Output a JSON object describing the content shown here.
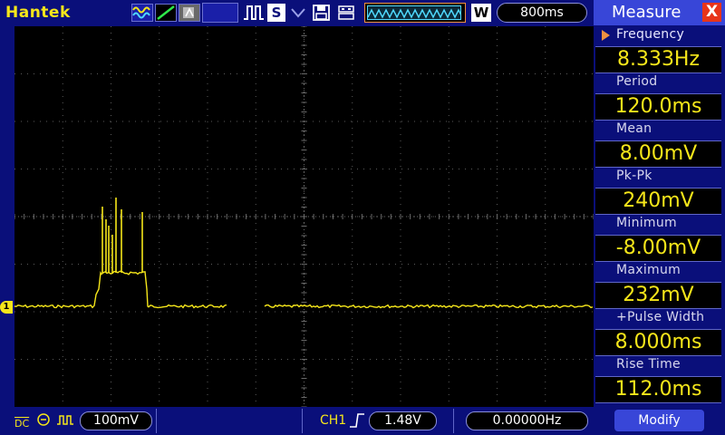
{
  "brand": "Hantek",
  "toolbar": {
    "run_mode_label": "S",
    "trigger_mode_label": "W",
    "timebase": "800ms"
  },
  "bottom": {
    "ch1_coupling": "DC",
    "ch1_volts_div": "100mV",
    "trigger_source": "CH1",
    "trigger_level": "1.48V",
    "trigger_freq": "0.00000Hz"
  },
  "measure": {
    "title": "Measure",
    "close": "X",
    "items": [
      {
        "label": "Frequency",
        "value": "8.333Hz"
      },
      {
        "label": "Period",
        "value": "120.0ms"
      },
      {
        "label": "Mean",
        "value": "8.00mV"
      },
      {
        "label": "Pk-Pk",
        "value": "240mV"
      },
      {
        "label": "Minimum",
        "value": "-8.00mV"
      },
      {
        "label": "Maximum",
        "value": "232mV"
      },
      {
        "label": "+Pulse Width",
        "value": "8.000ms"
      },
      {
        "label": "Rise Time",
        "value": "112.0ms"
      }
    ],
    "modify_label": "Modify"
  },
  "channel_marker": "1",
  "colors": {
    "trace": "#f5e61a",
    "frame": "#0a0f7a",
    "grid": "#5a5a5a"
  }
}
